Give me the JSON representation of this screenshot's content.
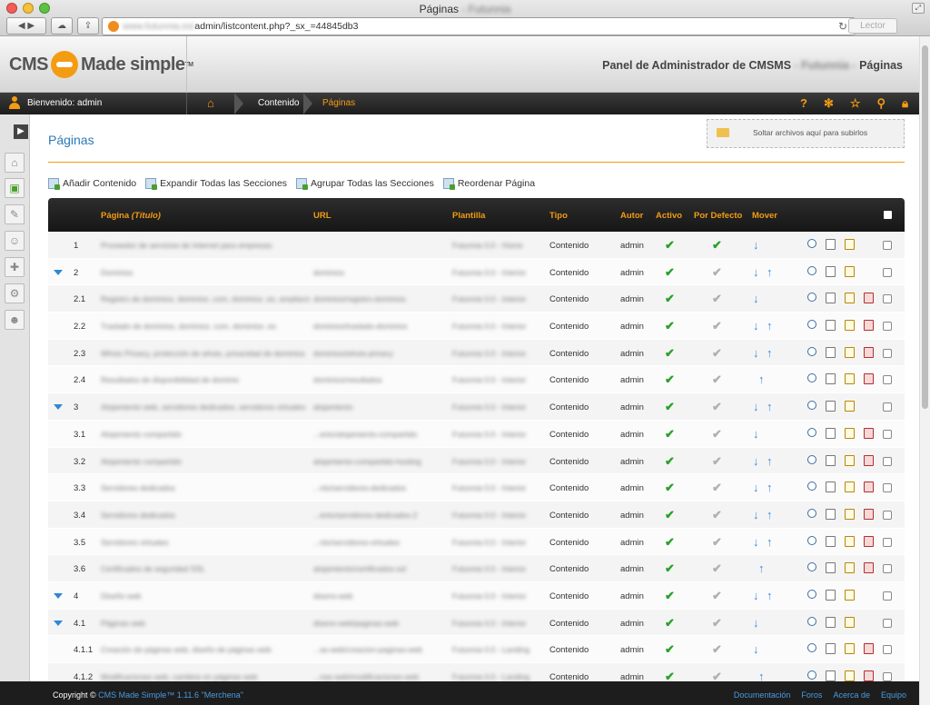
{
  "window": {
    "title": "Páginas",
    "title_suffix": "- Futunnia"
  },
  "browser": {
    "url_host": "www.futunnia.es/",
    "url_path": "admin/listcontent.php?_sx_=44845db3",
    "reader_label": "Lector"
  },
  "header": {
    "logo_text_left": "CMS",
    "logo_text_right": "Made simple",
    "logo_tm": "TM",
    "panel_title": "Panel de Administrador de CMSMS",
    "site_name": "- Futunnia -",
    "section": "Páginas"
  },
  "nav": {
    "welcome": "Bienvenido: admin",
    "crumbs": [
      "Contenido",
      "Páginas"
    ],
    "icons": [
      "help-icon",
      "gear-icon",
      "star-icon",
      "search-icon",
      "lock-icon"
    ]
  },
  "sidebar": {
    "icons": [
      "home-icon",
      "content-icon",
      "layout-icon",
      "users-icon",
      "extensions-icon",
      "settings-icon",
      "my-preferences-icon"
    ]
  },
  "page": {
    "title": "Páginas",
    "dropzone": "Soltar archivos aquí para subirlos"
  },
  "actions": [
    "Añadir Contenido",
    "Expandir Todas las Secciones",
    "Agrupar Todas las Secciones",
    "Reordenar Página"
  ],
  "table": {
    "headers": {
      "page": "Página",
      "page_em": "(Título)",
      "url": "URL",
      "template": "Plantilla",
      "type": "Tipo",
      "author": "Autor",
      "active": "Activo",
      "default": "Por Defecto",
      "move": "Mover"
    },
    "rows": [
      {
        "num": "1",
        "title": "Proveedor de servicios de Internet para empresas",
        "url": "",
        "template": "Futunnia 0.0 - Home",
        "type": "Contenido",
        "author": "admin",
        "expand": false,
        "default": true,
        "move": "down",
        "del": false
      },
      {
        "num": "2",
        "title": "Dominios",
        "url": "dominios",
        "template": "Futunnia 0.0 - Interior",
        "type": "Contenido",
        "author": "admin",
        "expand": true,
        "default": false,
        "move": "both",
        "del": false
      },
      {
        "num": "2.1",
        "title": "Registro de dominios, dominios .com, dominios .es, ampliación de registro",
        "url": "dominios/registro-dominios",
        "template": "Futunnia 0.0 - Interior",
        "type": "Contenido",
        "author": "admin",
        "expand": false,
        "default": false,
        "move": "down",
        "del": true
      },
      {
        "num": "2.2",
        "title": "Traslado de dominios, dominios .com, dominios .es",
        "url": "dominios/traslado-dominios",
        "template": "Futunnia 0.0 - Interior",
        "type": "Contenido",
        "author": "admin",
        "expand": false,
        "default": false,
        "move": "both",
        "del": true
      },
      {
        "num": "2.3",
        "title": "Whois Privacy, protección de whois, privacidad de dominios",
        "url": "dominios/whois-privacy",
        "template": "Futunnia 0.0 - Interior",
        "type": "Contenido",
        "author": "admin",
        "expand": false,
        "default": false,
        "move": "both",
        "del": true
      },
      {
        "num": "2.4",
        "title": "Resultados de disponibilidad de dominio",
        "url": "dominios/resultados",
        "template": "Futunnia 0.0 - Interior",
        "type": "Contenido",
        "author": "admin",
        "expand": false,
        "default": false,
        "move": "up",
        "del": true
      },
      {
        "num": "3",
        "title": "Alojamiento web, servidores dedicados, servidores virtuales",
        "url": "alojamiento",
        "template": "Futunnia 0.0 - Interior",
        "type": "Contenido",
        "author": "admin",
        "expand": true,
        "default": false,
        "move": "both",
        "del": false
      },
      {
        "num": "3.1",
        "title": "Alojamiento compartido",
        "url": "...ento/alojamiento-compartido",
        "template": "Futunnia 0.0 - Interior",
        "type": "Contenido",
        "author": "admin",
        "expand": false,
        "default": false,
        "move": "down",
        "del": true
      },
      {
        "num": "3.2",
        "title": "Alojamiento compartido",
        "url": "alojamiento-compartido-hosting",
        "template": "Futunnia 0.0 - Interior",
        "type": "Contenido",
        "author": "admin",
        "expand": false,
        "default": false,
        "move": "both",
        "del": true
      },
      {
        "num": "3.3",
        "title": "Servidores dedicados",
        "url": "...nto/servidores-dedicados",
        "template": "Futunnia 0.0 - Interior",
        "type": "Contenido",
        "author": "admin",
        "expand": false,
        "default": false,
        "move": "both",
        "del": true
      },
      {
        "num": "3.4",
        "title": "Servidores dedicados",
        "url": "...ento/servidores-dedicados-2",
        "template": "Futunnia 0.0 - Interior",
        "type": "Contenido",
        "author": "admin",
        "expand": false,
        "default": false,
        "move": "both",
        "del": true
      },
      {
        "num": "3.5",
        "title": "Servidores virtuales",
        "url": "...nto/servidores-virtuales",
        "template": "Futunnia 0.0 - Interior",
        "type": "Contenido",
        "author": "admin",
        "expand": false,
        "default": false,
        "move": "both",
        "del": true
      },
      {
        "num": "3.6",
        "title": "Certificados de seguridad SSL",
        "url": "alojamiento/certificados-ssl",
        "template": "Futunnia 0.0 - Interior",
        "type": "Contenido",
        "author": "admin",
        "expand": false,
        "default": false,
        "move": "up",
        "del": true
      },
      {
        "num": "4",
        "title": "Diseño web",
        "url": "diseno-web",
        "template": "Futunnia 0.0 - Interior",
        "type": "Contenido",
        "author": "admin",
        "expand": true,
        "default": false,
        "move": "both",
        "del": false
      },
      {
        "num": "4.1",
        "title": "Páginas web",
        "url": "diseno-web/paginas-web",
        "template": "Futunnia 0.0 - Interior",
        "type": "Contenido",
        "author": "admin",
        "expand": true,
        "default": false,
        "move": "down",
        "del": false
      },
      {
        "num": "4.1.1",
        "title": "Creación de páginas web, diseño de páginas web",
        "url": "...as-web/creacion-paginas-web",
        "template": "Futunnia 0.0 - Landing",
        "type": "Contenido",
        "author": "admin",
        "expand": false,
        "default": false,
        "move": "down",
        "del": true
      },
      {
        "num": "4.1.2",
        "title": "Modificaciones web, cambios en páginas web",
        "url": "...nas-web/modificaciones-web",
        "template": "Futunnia 0.0 - Landing",
        "type": "Contenido",
        "author": "admin",
        "expand": false,
        "default": false,
        "move": "up",
        "del": true
      }
    ]
  },
  "footer": {
    "copyright": "Copyright ©",
    "product": "CMS Made Simple™ 1.11.6 \"Merchena\"",
    "links": [
      "Documentación",
      "Foros",
      "Acerca de",
      "Equipo"
    ]
  },
  "colors": {
    "accent": "#f39c12",
    "link": "#2a7ab8",
    "active_check": "#2aa02a",
    "move_arrow": "#3a8de0"
  }
}
